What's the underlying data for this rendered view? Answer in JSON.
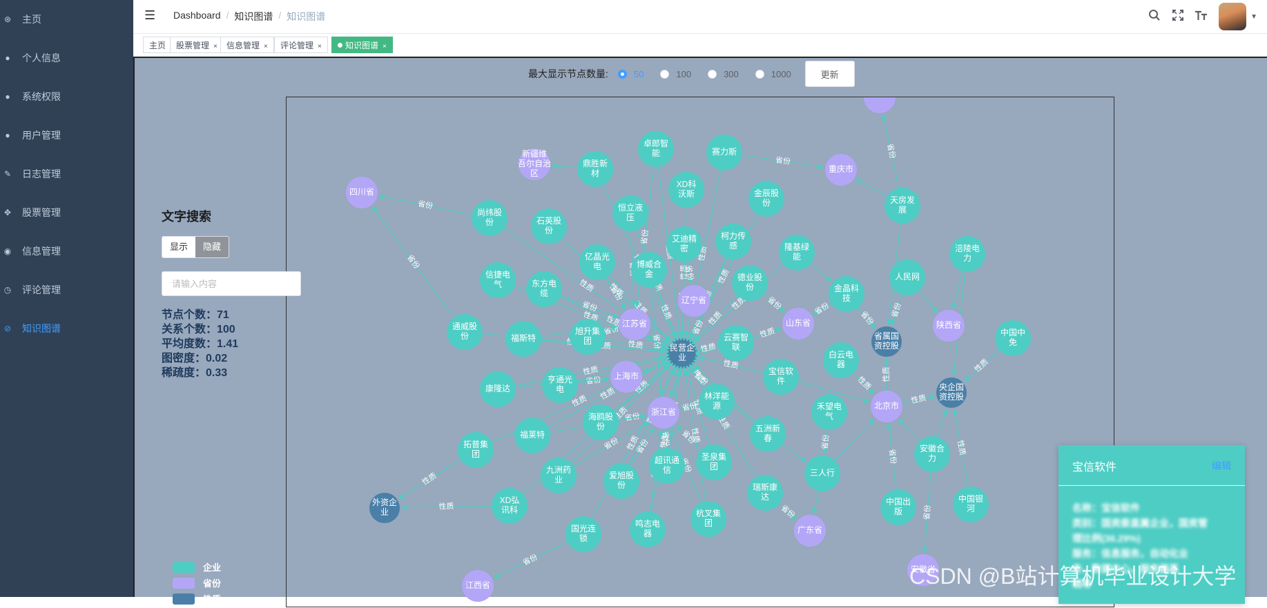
{
  "sidebar": {
    "items": [
      {
        "label": "主页",
        "icon": "dashboard-icon",
        "glyph": "⊛",
        "active": false
      },
      {
        "label": "个人信息",
        "icon": "user-icon",
        "glyph": "●",
        "active": false
      },
      {
        "label": "系统权限",
        "icon": "user-shield-icon",
        "glyph": "●",
        "active": false
      },
      {
        "label": "用户管理",
        "icon": "users-icon",
        "glyph": "●",
        "active": false
      },
      {
        "label": "日志管理",
        "icon": "feather-icon",
        "glyph": "✎",
        "active": false
      },
      {
        "label": "股票管理",
        "icon": "move-icon",
        "glyph": "✥",
        "active": false
      },
      {
        "label": "信息管理",
        "icon": "location-icon",
        "glyph": "◉",
        "active": false
      },
      {
        "label": "评论管理",
        "icon": "clock-icon",
        "glyph": "◷",
        "active": false
      },
      {
        "label": "知识图谱",
        "icon": "graph-icon",
        "glyph": "⊘",
        "active": true
      }
    ]
  },
  "navbar": {
    "breadcrumb": [
      "Dashboard",
      "知识图谱",
      "知识图谱"
    ]
  },
  "tags": [
    {
      "label": "主页",
      "closable": false,
      "active": false
    },
    {
      "label": "股票管理",
      "closable": true,
      "active": false
    },
    {
      "label": "信息管理",
      "closable": true,
      "active": false
    },
    {
      "label": "评论管理",
      "closable": true,
      "active": false
    },
    {
      "label": "知识图谱",
      "closable": true,
      "active": true
    }
  ],
  "controls": {
    "label": "最大显示节点数量:",
    "options": [
      "50",
      "100",
      "300",
      "1000"
    ],
    "selected": "50",
    "update_label": "更新"
  },
  "search": {
    "title": "文字搜索",
    "show_label": "显示",
    "hide_label": "隐藏",
    "placeholder": "请输入内容"
  },
  "stats": {
    "nodes": "节点个数：71",
    "relations": "关系个数：100",
    "avg_degree": "平均度数：1.41",
    "density": "图密度：0.02",
    "sparsity": "稀疏度：0.33"
  },
  "legend": [
    {
      "label": "企业",
      "color": "#4ecdc4"
    },
    {
      "label": "省份",
      "color": "#b3a6f7"
    },
    {
      "label": "性质",
      "color": "#4a7fa7"
    }
  ],
  "colors": {
    "company": "#4ecdc4",
    "province": "#b3a6f7",
    "nature": "#4a7fa7",
    "accent": "#409eff",
    "tag_active": "#42b983"
  },
  "info_card": {
    "title": "宝信软件",
    "edit_label": "编辑",
    "lines": [
      "名称：宝信软件",
      "类别：国资委直属企业，国资管",
      "理比例(36.29%)",
      "服务：信息服务，自动化业",
      "务，数据中心，服务器基",
      "础等"
    ]
  },
  "watermark": "CSDN @B站计算机毕业设计大学",
  "graph": {
    "nodes": [
      {
        "id": "sc",
        "label": "四川省",
        "type": "province"
      },
      {
        "id": "xj",
        "label": "新疆维\n吾尔自治\n区",
        "type": "province"
      },
      {
        "id": "cq",
        "label": "重庆市",
        "type": "province"
      },
      {
        "id": "ln",
        "label": "辽宁省",
        "type": "province"
      },
      {
        "id": "js",
        "label": "江苏省",
        "type": "province"
      },
      {
        "id": "sd",
        "label": "山东省",
        "type": "province"
      },
      {
        "id": "sx",
        "label": "陕西省",
        "type": "province"
      },
      {
        "id": "sh",
        "label": "上海市",
        "type": "province"
      },
      {
        "id": "zj",
        "label": "浙江省",
        "type": "province"
      },
      {
        "id": "bj",
        "label": "北京市",
        "type": "province"
      },
      {
        "id": "gd",
        "label": "广东省",
        "type": "province"
      },
      {
        "id": "jx",
        "label": "江西省",
        "type": "province"
      },
      {
        "id": "ah",
        "label": "安徽省",
        "type": "province"
      },
      {
        "id": "top",
        "label": "",
        "type": "province"
      },
      {
        "id": "my",
        "label": "民营企\n业",
        "type": "nature"
      },
      {
        "id": "sd2",
        "label": "省属国\n资控股",
        "type": "nature"
      },
      {
        "id": "yq",
        "label": "央企国\n资控股",
        "type": "nature"
      },
      {
        "id": "wz",
        "label": "外资企\n业",
        "type": "nature"
      },
      {
        "id": "c1",
        "label": "卓郎智\n能",
        "type": "company"
      },
      {
        "id": "c2",
        "label": "鼎胜新\n材",
        "type": "company"
      },
      {
        "id": "c3",
        "label": "赛力斯",
        "type": "company"
      },
      {
        "id": "c4",
        "label": "XD科\n沃斯",
        "type": "company"
      },
      {
        "id": "c5",
        "label": "金辰股\n份",
        "type": "company"
      },
      {
        "id": "c6",
        "label": "天房发\n展",
        "type": "company"
      },
      {
        "id": "c7",
        "label": "尚纬股\n份",
        "type": "company"
      },
      {
        "id": "c8",
        "label": "石英股\n份",
        "type": "company"
      },
      {
        "id": "c9",
        "label": "恒立液\n压",
        "type": "company"
      },
      {
        "id": "c10",
        "label": "艾迪精\n密",
        "type": "company"
      },
      {
        "id": "c11",
        "label": "柯力传\n感",
        "type": "company"
      },
      {
        "id": "c12",
        "label": "隆基绿\n能",
        "type": "company"
      },
      {
        "id": "c13",
        "label": "涪陵电\n力",
        "type": "company"
      },
      {
        "id": "c14",
        "label": "亿晶光\n电",
        "type": "company"
      },
      {
        "id": "c15",
        "label": "博威合\n金",
        "type": "company"
      },
      {
        "id": "c16",
        "label": "信捷电\n气",
        "type": "company"
      },
      {
        "id": "c17",
        "label": "东方电\n缆",
        "type": "company"
      },
      {
        "id": "c18",
        "label": "德业股\n份",
        "type": "company"
      },
      {
        "id": "c19",
        "label": "金晶科\n技",
        "type": "company"
      },
      {
        "id": "c20",
        "label": "人民网",
        "type": "company"
      },
      {
        "id": "c21",
        "label": "通威股\n份",
        "type": "company"
      },
      {
        "id": "c22",
        "label": "福斯特",
        "type": "company"
      },
      {
        "id": "c23",
        "label": "旭升集\n团",
        "type": "company"
      },
      {
        "id": "c24",
        "label": "云赛智\n联",
        "type": "company"
      },
      {
        "id": "c25",
        "label": "白云电\n器",
        "type": "company"
      },
      {
        "id": "c26",
        "label": "中国中\n免",
        "type": "company"
      },
      {
        "id": "c27",
        "label": "宝信软\n件",
        "type": "company"
      },
      {
        "id": "c28",
        "label": "康隆达",
        "type": "company"
      },
      {
        "id": "c29",
        "label": "亨通光\n电",
        "type": "company"
      },
      {
        "id": "c30",
        "label": "林洋能\n源",
        "type": "company"
      },
      {
        "id": "c31",
        "label": "禾望电\n气",
        "type": "company"
      },
      {
        "id": "c32",
        "label": "拓普集\n团",
        "type": "company"
      },
      {
        "id": "c33",
        "label": "福莱特",
        "type": "company"
      },
      {
        "id": "c34",
        "label": "海鸥股\n份",
        "type": "company"
      },
      {
        "id": "c35",
        "label": "五洲新\n春",
        "type": "company"
      },
      {
        "id": "c36",
        "label": "安徽合\n力",
        "type": "company"
      },
      {
        "id": "c37",
        "label": "九洲药\n业",
        "type": "company"
      },
      {
        "id": "c38",
        "label": "爱旭股\n份",
        "type": "company"
      },
      {
        "id": "c39",
        "label": "超讯通\n信",
        "type": "company"
      },
      {
        "id": "c40",
        "label": "圣泉集\n团",
        "type": "company"
      },
      {
        "id": "c41",
        "label": "三人行",
        "type": "company"
      },
      {
        "id": "c42",
        "label": "XD弘\n讯科",
        "type": "company"
      },
      {
        "id": "c43",
        "label": "瑞斯康\n达",
        "type": "company"
      },
      {
        "id": "c44",
        "label": "中国出\n版",
        "type": "company"
      },
      {
        "id": "c45",
        "label": "中国银\n河",
        "type": "company"
      },
      {
        "id": "c46",
        "label": "杭叉集\n团",
        "type": "company"
      },
      {
        "id": "c47",
        "label": "鸣志电\n器",
        "type": "company"
      },
      {
        "id": "c48",
        "label": "国光连\n锁",
        "type": "company"
      }
    ],
    "edge_labels": [
      "省份",
      "性质"
    ]
  }
}
